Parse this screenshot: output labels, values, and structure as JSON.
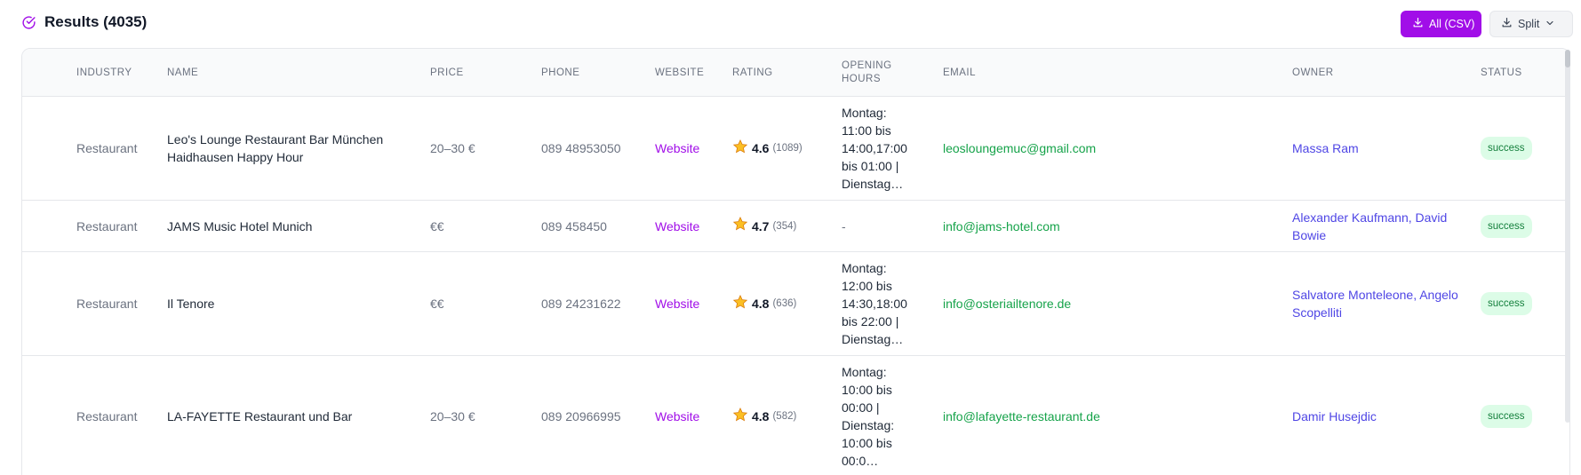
{
  "header": {
    "title": "Results (4035)",
    "csv_label": "All (CSV)",
    "split_label": "Split"
  },
  "columns": {
    "industry": "INDUSTRY",
    "name": "NAME",
    "price": "PRICE",
    "phone": "PHONE",
    "website": "WEBSITE",
    "rating": "RATING",
    "opening_hours": "OPENING HOURS",
    "email": "EMAIL",
    "owner": "OWNER",
    "status": "STATUS"
  },
  "rows": [
    {
      "industry": "Restaurant",
      "name": "Leo's Lounge Restaurant Bar München Haidhausen Happy Hour",
      "price": "20–30 €",
      "phone": "089 48953050",
      "website": "Website",
      "rating": "4.6",
      "rating_count": "(1089)",
      "opening_hours": "Montag: 11:00 bis 14:00,17:00 bis 01:00 | Dienstag…",
      "email": "leosloungemuc@gmail.com",
      "owner": "Massa Ram",
      "status": "success"
    },
    {
      "industry": "Restaurant",
      "name": "JAMS Music Hotel Munich",
      "price": "€€",
      "phone": "089 458450",
      "website": "Website",
      "rating": "4.7",
      "rating_count": "(354)",
      "opening_hours": "-",
      "email": "info@jams-hotel.com",
      "owner": "Alexander Kaufmann, David Bowie",
      "status": "success"
    },
    {
      "industry": "Restaurant",
      "name": "Il Tenore",
      "price": "€€",
      "phone": "089 24231622",
      "website": "Website",
      "rating": "4.8",
      "rating_count": "(636)",
      "opening_hours": "Montag: 12:00 bis 14:30,18:00 bis 22:00 | Dienstag…",
      "email": "info@osteriailtenore.de",
      "owner": "Salvatore Monteleone, Angelo Scopelliti",
      "status": "success"
    },
    {
      "industry": "Restaurant",
      "name": "LA-FAYETTE Restaurant und Bar",
      "price": "20–30 €",
      "phone": "089 20966995",
      "website": "Website",
      "rating": "4.8",
      "rating_count": "(582)",
      "opening_hours": "Montag: 10:00 bis 00:00 | Dienstag: 10:00 bis 00:0…",
      "email": "info@lafayette-restaurant.de",
      "owner": "Damir Husejdic",
      "status": "success"
    }
  ],
  "icons": {
    "title": "check-circle-icon",
    "csv": "download-icon",
    "split": "download-icon",
    "split_caret": "chevron-down-icon",
    "rating": "star-icon"
  },
  "colors": {
    "accent": "#a10ee8",
    "email": "#16a34a",
    "owner": "#4f46e5",
    "badge_bg": "#dcfce7",
    "badge_text": "#15803d"
  }
}
